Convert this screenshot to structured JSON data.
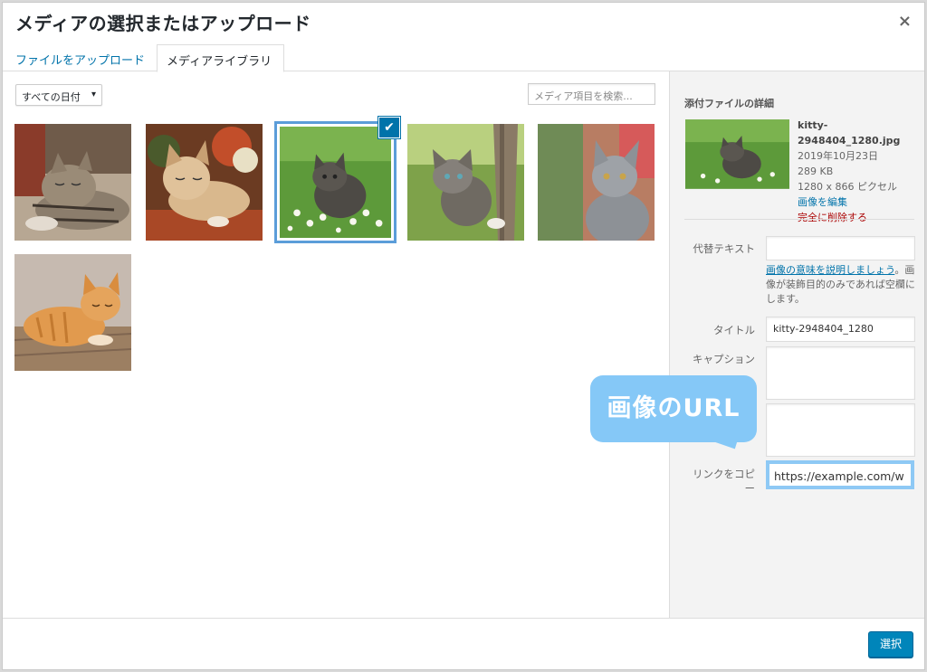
{
  "dialog": {
    "title": "メディアの選択またはアップロード",
    "close": "×"
  },
  "tabs": [
    {
      "label": "ファイルをアップロード"
    },
    {
      "label": "メディアライブラリ"
    }
  ],
  "toolbar": {
    "date_filter": "すべての日付",
    "date_arrow": "▾",
    "search_placeholder": "メディア項目を検索..."
  },
  "grid": {
    "check_icon": "✔"
  },
  "details": {
    "heading": "添付ファイルの詳細",
    "filename": "kitty-2948404_1280.jpg",
    "date": "2019年10月23日",
    "size": "289 KB",
    "dimensions": "1280 x 866 ピクセル",
    "edit_link": "画像を編集",
    "delete_link": "完全に削除する"
  },
  "fields": {
    "alt_label": "代替テキスト",
    "alt_value": "",
    "alt_help_link": "画像の意味を説明しましょう",
    "alt_help_text": "。画像が装飾目的のみであれば空欄にします。",
    "title_label": "タイトル",
    "title_value": "kitty-2948404_1280",
    "caption_label": "キャプション",
    "caption_value": "",
    "description_value": "",
    "copy_link_label": "リンクをコピー",
    "copy_link_value": "https://example.com/w"
  },
  "annotation": {
    "bubble_text": "画像のURL",
    "color": "#85c8f7"
  },
  "footer": {
    "select_button": "選択"
  },
  "colors": {
    "accent": "#0073aa",
    "primary_button": "#0085ba",
    "delete": "#a00000"
  }
}
